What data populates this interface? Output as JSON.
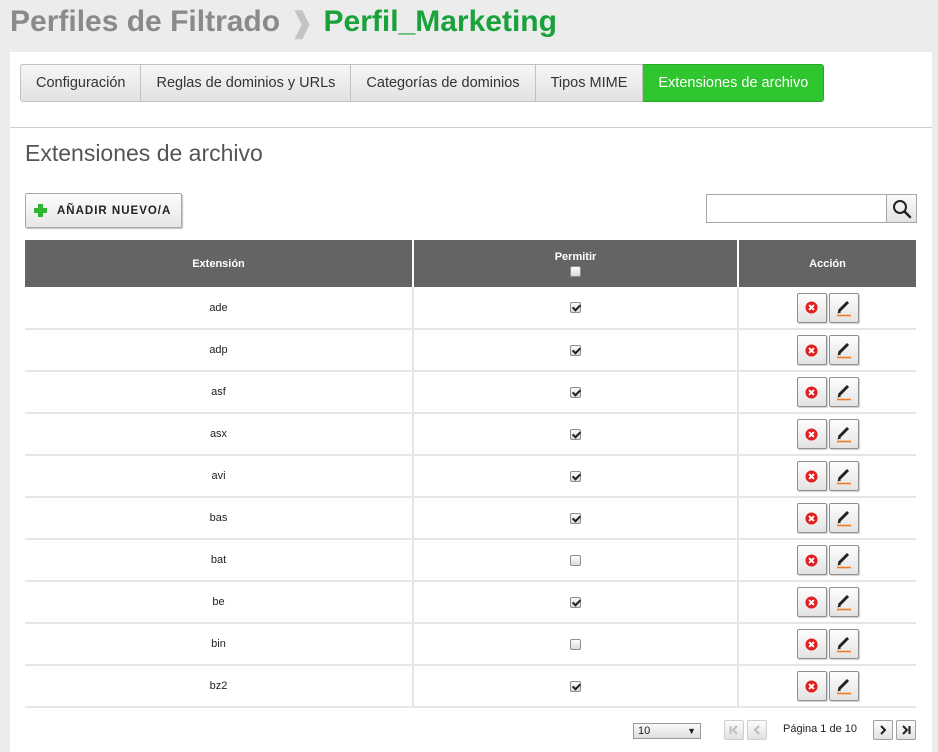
{
  "breadcrumb": {
    "parent": "Perfiles de Filtrado",
    "separator": "❱",
    "current": "Perfil_Marketing"
  },
  "tabs": [
    {
      "label": "Configuración",
      "active": false
    },
    {
      "label": "Reglas de dominios y URLs",
      "active": false
    },
    {
      "label": "Categorías de dominios",
      "active": false
    },
    {
      "label": "Tipos MIME",
      "active": false
    },
    {
      "label": "Extensiones de archivo",
      "active": true
    }
  ],
  "section": {
    "title": "Extensiones de archivo",
    "add_button_label": "AÑADIR NUEVO/A"
  },
  "search": {
    "value": "",
    "placeholder": "",
    "icon": "search-icon"
  },
  "table": {
    "columns": {
      "extension": "Extensión",
      "permit": "Permitir",
      "action": "Acción"
    },
    "header_permit_all_checked": false,
    "rows": [
      {
        "extension": "ade",
        "permit": true
      },
      {
        "extension": "adp",
        "permit": true
      },
      {
        "extension": "asf",
        "permit": true
      },
      {
        "extension": "asx",
        "permit": true
      },
      {
        "extension": "avi",
        "permit": true
      },
      {
        "extension": "bas",
        "permit": true
      },
      {
        "extension": "bat",
        "permit": false
      },
      {
        "extension": "be",
        "permit": true
      },
      {
        "extension": "bin",
        "permit": false
      },
      {
        "extension": "bz2",
        "permit": true
      }
    ],
    "row_action_icons": [
      "delete-icon",
      "edit-icon"
    ]
  },
  "pagination": {
    "page_size": "10",
    "page_info": "Página 1 de 10",
    "icons": [
      "first-page-icon",
      "prev-page-icon",
      "next-page-icon",
      "last-page-icon"
    ]
  },
  "colors": {
    "accent_green": "#2fc52f",
    "breadcrumb_green": "#19a23a",
    "header_gray": "#646464",
    "delete_red": "#e02020",
    "edit_orange": "#f07a20"
  }
}
